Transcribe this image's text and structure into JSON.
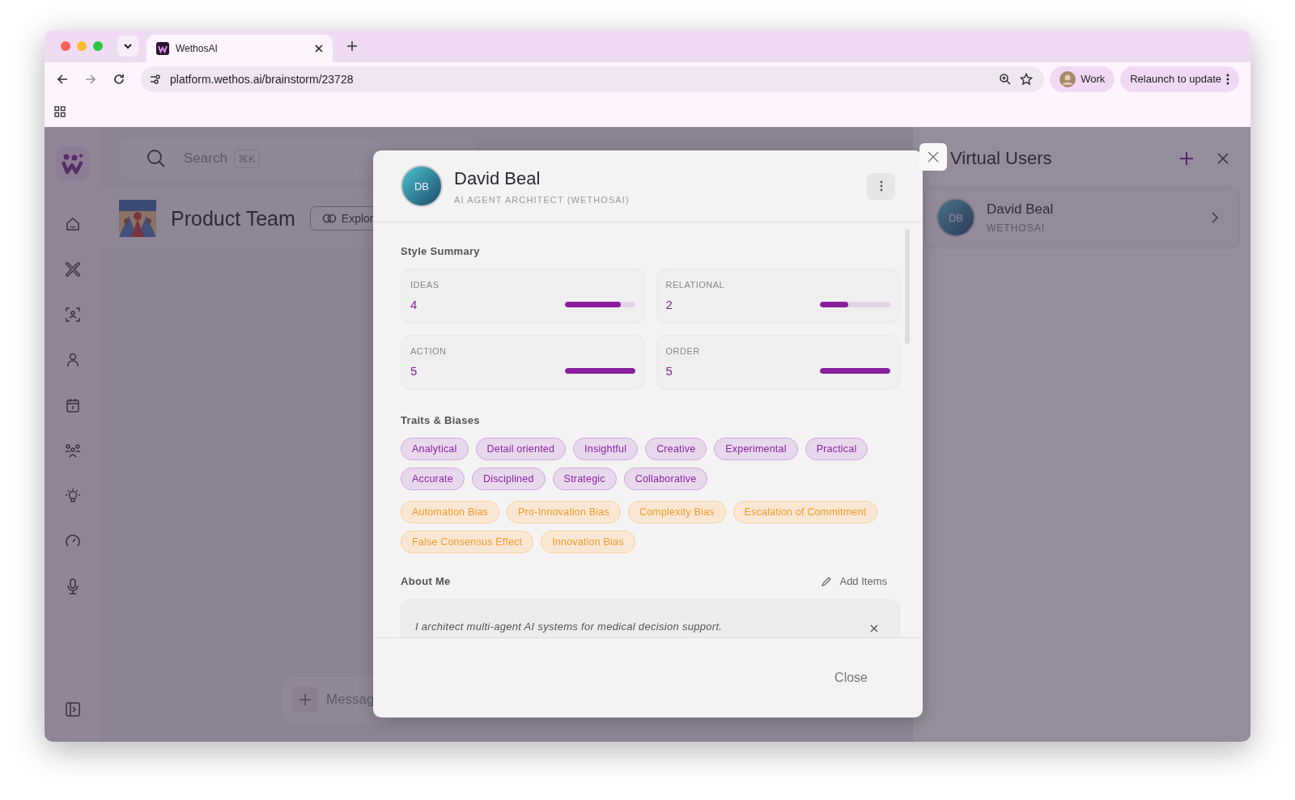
{
  "browser": {
    "tab_title": "WethosAI",
    "url": "platform.wethos.ai/brainstorm/23728",
    "profile": "Work",
    "relaunch": "Relaunch to update"
  },
  "app": {
    "search_placeholder": "Search",
    "search_shortcut": "⌘K",
    "team_name": "Product Team",
    "explore_button": "Explor",
    "message_placeholder": "Messag"
  },
  "sidebar": {
    "items": [
      {
        "kind": "home"
      },
      {
        "kind": "tools"
      },
      {
        "kind": "scan"
      },
      {
        "kind": "person"
      },
      {
        "kind": "calendar"
      },
      {
        "kind": "group"
      },
      {
        "kind": "idea"
      },
      {
        "kind": "gauge"
      },
      {
        "kind": "mic"
      }
    ]
  },
  "virtual_users": {
    "title": "Virtual Users",
    "users": [
      {
        "initials": "DB",
        "name": "David Beal",
        "org": "WETHOSAI"
      }
    ]
  },
  "modal": {
    "initials": "DB",
    "name": "David Beal",
    "role": "AI AGENT ARCHITECT (WETHOSAI)",
    "style_summary": {
      "title": "Style Summary",
      "metrics": [
        {
          "label": "IDEAS",
          "value": "4",
          "level": 0.8
        },
        {
          "label": "RELATIONAL",
          "value": "2",
          "level": 0.4
        },
        {
          "label": "ACTION",
          "value": "5",
          "level": 1
        },
        {
          "label": "ORDER",
          "value": "5",
          "level": 1
        }
      ]
    },
    "traits_title": "Traits & Biases",
    "traits": [
      {
        "label": "Analytical",
        "kind": "trait"
      },
      {
        "label": "Detail oriented",
        "kind": "trait"
      },
      {
        "label": "Insightful",
        "kind": "trait"
      },
      {
        "label": "Creative",
        "kind": "trait"
      },
      {
        "label": "Experimental",
        "kind": "trait"
      },
      {
        "label": "Practical",
        "kind": "trait"
      },
      {
        "label": "Accurate",
        "kind": "trait"
      },
      {
        "label": "Disciplined",
        "kind": "trait"
      },
      {
        "label": "Strategic",
        "kind": "trait"
      },
      {
        "label": "Collaborative",
        "kind": "trait"
      }
    ],
    "biases": [
      {
        "label": "Automation Bias",
        "kind": "bias"
      },
      {
        "label": "Pro-Innovation Bias",
        "kind": "bias"
      },
      {
        "label": "Complexity Bias",
        "kind": "bias"
      },
      {
        "label": "Escalation of Commitment",
        "kind": "bias"
      },
      {
        "label": "False Consensus Effect",
        "kind": "bias"
      },
      {
        "label": "Innovation Bias",
        "kind": "bias"
      }
    ],
    "about_title": "About Me",
    "add_items": "Add Items",
    "about_items": [
      "I architect multi-agent AI systems for medical decision support."
    ],
    "close_button": "Close"
  }
}
